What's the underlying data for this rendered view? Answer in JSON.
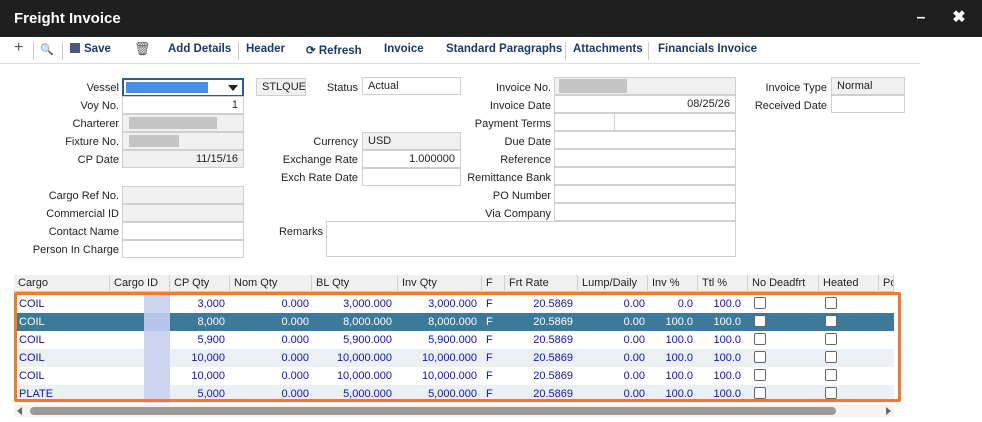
{
  "window": {
    "title": "Freight Invoice",
    "minimize": "–",
    "close": "✖"
  },
  "toolbar": {
    "add_icon": "+",
    "search_icon": "🔍",
    "save": "Save",
    "delete_icon": "🗑",
    "add_details": "Add Details",
    "header": "Header",
    "refresh_icon": "⟳",
    "refresh": "Refresh",
    "invoice": "Invoice",
    "standard_paragraphs": "Standard Paragraphs",
    "attachments": "Attachments",
    "financials_invoice": "Financials Invoice"
  },
  "form": {
    "vessel_label": "Vessel",
    "stlque": "STLQUE",
    "voy_label": "Voy No.",
    "voy_value": "1",
    "charterer_label": "Charterer",
    "fixture_label": "Fixture No.",
    "cpdate_label": "CP Date",
    "cpdate_value": "11/15/16",
    "cargo_ref_label": "Cargo Ref No.",
    "commercial_id_label": "Commercial ID",
    "contact_label": "Contact Name",
    "person_label": "Person In Charge",
    "status_label": "Status",
    "status_value": "Actual",
    "currency_label": "Currency",
    "currency_value": "USD",
    "exrate_label": "Exchange Rate",
    "exrate_value": "1.000000",
    "exrate_date_label": "Exch Rate Date",
    "remarks_label": "Remarks",
    "invoice_no_label": "Invoice No.",
    "invoice_date_label": "Invoice Date",
    "invoice_date_value": "08/25/26",
    "payment_terms_label": "Payment Terms",
    "due_date_label": "Due Date",
    "reference_label": "Reference",
    "remittance_label": "Remittance Bank",
    "po_label": "PO Number",
    "via_label": "Via Company",
    "invoice_type_label": "Invoice Type",
    "invoice_type_value": "Normal",
    "received_date_label": "Received Date"
  },
  "grid": {
    "headers": [
      "Cargo",
      "Cargo ID",
      "CP Qty",
      "Nom Qty",
      "BL Qty",
      "Inv Qty",
      "F",
      "Frt Rate",
      "Lump/Daily",
      "Inv %",
      "Ttl %",
      "No Deadfrt",
      "Heated",
      "Po"
    ],
    "rows": [
      {
        "cargo": "COIL",
        "cp": "3,000",
        "nom": "0.000",
        "bl": "3,000.000",
        "inv": "3,000.000",
        "f": "F",
        "frt": "20.5869",
        "lump": "0.00",
        "invp": "0.0",
        "ttl": "100.0"
      },
      {
        "cargo": "COIL",
        "cp": "8,000",
        "nom": "0.000",
        "bl": "8,000.000",
        "inv": "8,000.000",
        "f": "F",
        "frt": "20.5869",
        "lump": "0.00",
        "invp": "100.0",
        "ttl": "100.0"
      },
      {
        "cargo": "COIL",
        "cp": "5,900",
        "nom": "0.000",
        "bl": "5,900.000",
        "inv": "5,900.000",
        "f": "F",
        "frt": "20.5869",
        "lump": "0.00",
        "invp": "100.0",
        "ttl": "100.0"
      },
      {
        "cargo": "COIL",
        "cp": "10,000",
        "nom": "0.000",
        "bl": "10,000.000",
        "inv": "10,000.000",
        "f": "F",
        "frt": "20.5869",
        "lump": "0.00",
        "invp": "100.0",
        "ttl": "100.0"
      },
      {
        "cargo": "COIL",
        "cp": "10,000",
        "nom": "0.000",
        "bl": "10,000.000",
        "inv": "10,000.000",
        "f": "F",
        "frt": "20.5869",
        "lump": "0.00",
        "invp": "100.0",
        "ttl": "100.0"
      },
      {
        "cargo": "PLATE",
        "cp": "5,000",
        "nom": "0.000",
        "bl": "5,000.000",
        "inv": "5,000.000",
        "f": "F",
        "frt": "20.5869",
        "lump": "0.00",
        "invp": "100.0",
        "ttl": "100.0"
      }
    ]
  },
  "colors": {
    "selected_row": "#3d7a9a",
    "highlight_border": "#f07a2a",
    "grid_text": "#1010c8"
  }
}
